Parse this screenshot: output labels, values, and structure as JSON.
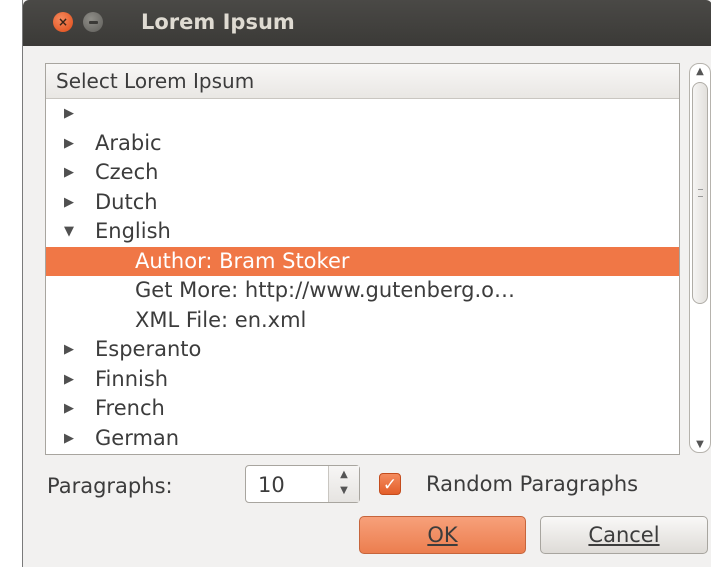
{
  "window": {
    "title": "Lorem Ipsum",
    "close_glyph": "×"
  },
  "tree": {
    "header": "Select Lorem Ipsum",
    "rows": [
      {
        "label": "",
        "expander": "▶"
      },
      {
        "label": "Arabic",
        "expander": "▶"
      },
      {
        "label": "Czech",
        "expander": "▶"
      },
      {
        "label": "Dutch",
        "expander": "▶"
      },
      {
        "label": "English",
        "expander": "▼"
      },
      {
        "label": "Author: Bram Stoker",
        "selected": true
      },
      {
        "label": "Get More: http://www.gutenberg.o…"
      },
      {
        "label": "XML File: en.xml"
      },
      {
        "label": "Esperanto",
        "expander": "▶"
      },
      {
        "label": "Finnish",
        "expander": "▶"
      },
      {
        "label": "French",
        "expander": "▶"
      },
      {
        "label": "German",
        "expander": "▶"
      }
    ]
  },
  "paragraphs": {
    "label": "Paragraphs:",
    "value": "10"
  },
  "random": {
    "label": "Random Paragraphs",
    "checked": true
  },
  "buttons": {
    "ok": "OK",
    "cancel": "Cancel"
  },
  "colors": {
    "accent": "#f07746",
    "titlebar": "#3c3b37",
    "window_bg": "#f2f1f0"
  }
}
